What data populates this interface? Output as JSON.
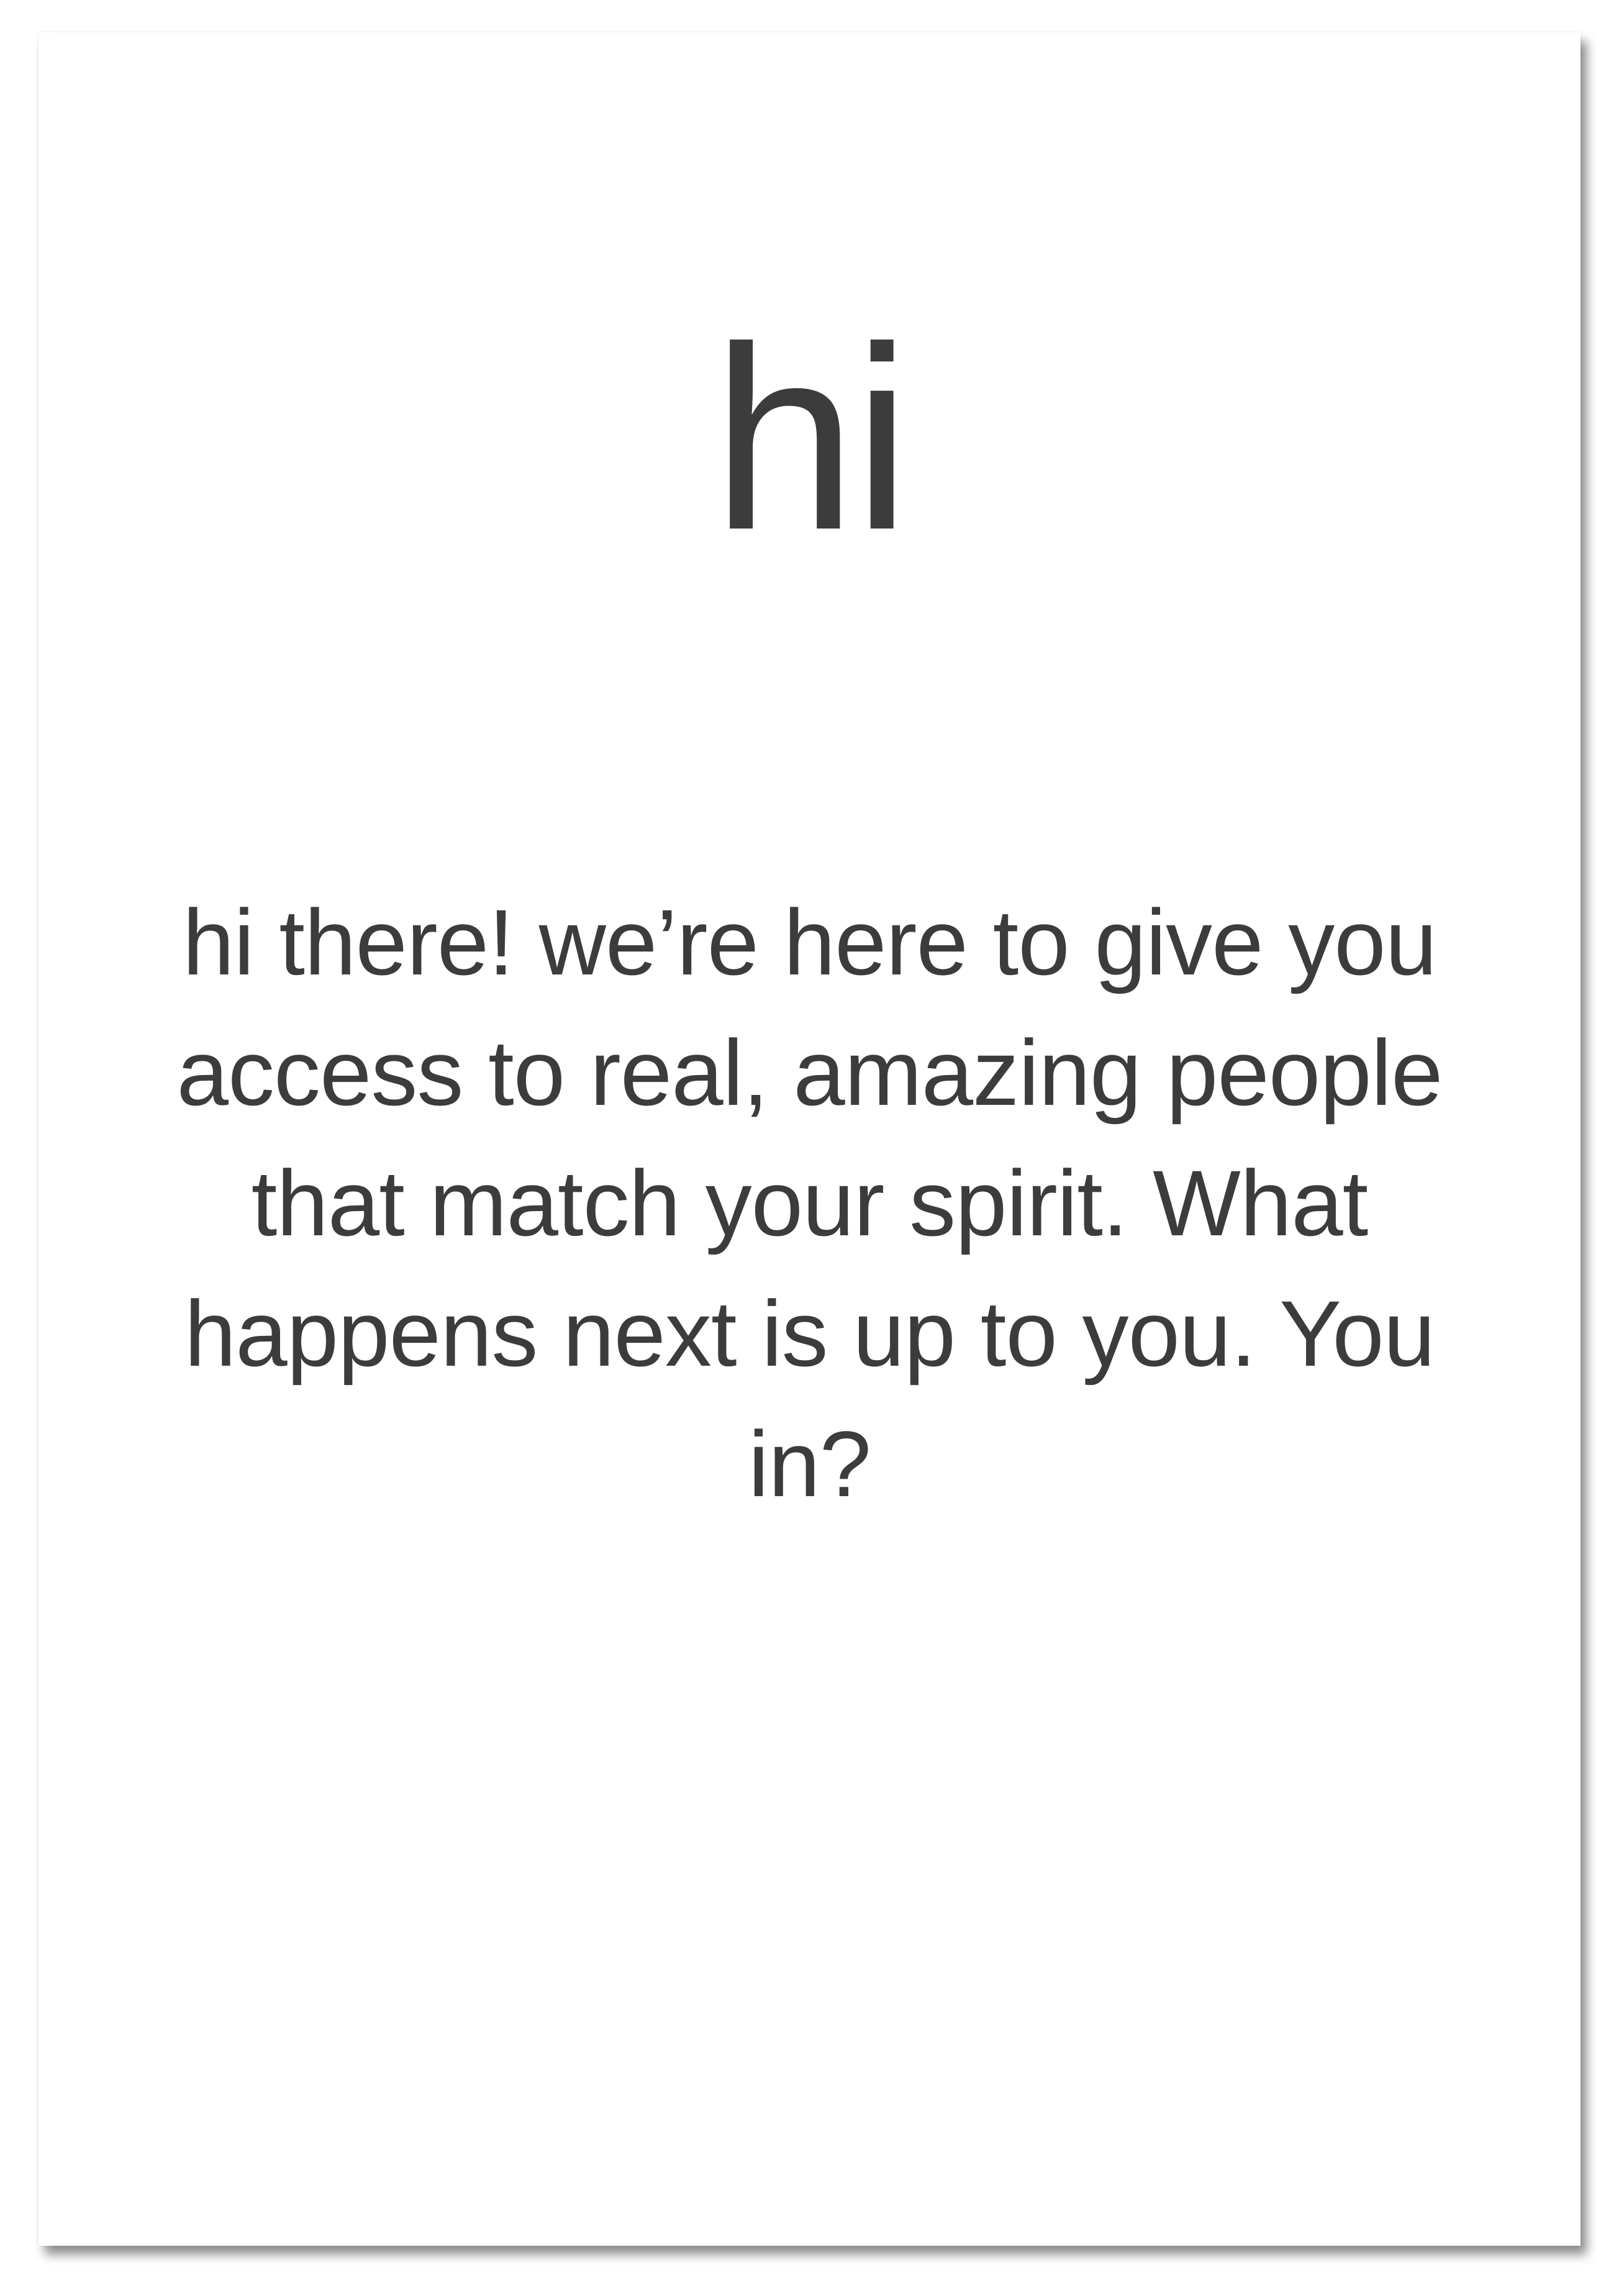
{
  "card": {
    "greeting": "hi",
    "message": "hi there! we’re here to give you access to real, amazing people that match your spirit. What happens next is up to you. You in?"
  },
  "colors": {
    "text": "#3c3c3d",
    "background": "#ffffff"
  }
}
